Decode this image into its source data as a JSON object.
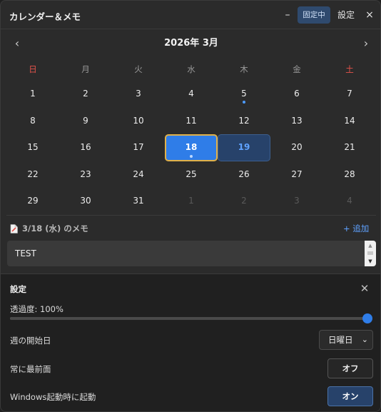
{
  "titlebar": {
    "title": "カレンダー＆メモ",
    "minimize_glyph": "–",
    "pin_label": "固定中",
    "settings_label": "設定",
    "close_glyph": "×"
  },
  "calendar": {
    "month_title": "2026年 3月",
    "prev_glyph": "‹",
    "next_glyph": "›",
    "weekdays": [
      "日",
      "月",
      "火",
      "水",
      "木",
      "金",
      "土"
    ],
    "weeks": [
      [
        "1",
        "2",
        "3",
        "4",
        "5",
        "6",
        "7"
      ],
      [
        "8",
        "9",
        "10",
        "11",
        "12",
        "13",
        "14"
      ],
      [
        "15",
        "16",
        "17",
        "18",
        "19",
        "20",
        "21"
      ],
      [
        "22",
        "23",
        "24",
        "25",
        "26",
        "27",
        "28"
      ],
      [
        "29",
        "30",
        "31",
        "1",
        "2",
        "3",
        "4"
      ]
    ],
    "selected_day": "18",
    "today_day": "19",
    "days_with_memo": [
      "5",
      "18"
    ],
    "colors": {
      "accent": "#2f7de8",
      "selected_border": "#e0b14a",
      "weekend": "#e5534b",
      "memo_dot": "#4d9bff"
    }
  },
  "memo": {
    "title": "3/18 (水) のメモ",
    "add_label": "+ 追加",
    "content": "TEST"
  },
  "settings": {
    "title": "設定",
    "close_glyph": "✕",
    "opacity_label": "透過度: 100%",
    "opacity_value": 1.0,
    "week_start_label": "週の開始日",
    "week_start_value": "日曜日",
    "always_on_top_label": "常に最前面",
    "always_on_top_value": "オフ",
    "startup_label": "Windows起動時に起動",
    "startup_value": "オン"
  }
}
